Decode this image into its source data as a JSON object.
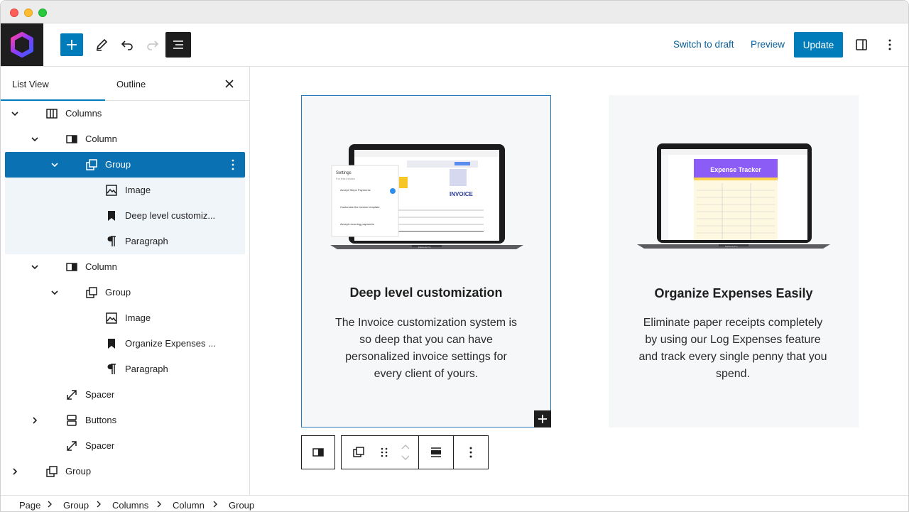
{
  "toolbar": {
    "switch_to_draft": "Switch to draft",
    "preview": "Preview",
    "update": "Update"
  },
  "panel": {
    "tabs": [
      "List View",
      "Outline"
    ],
    "active_tab": "List View",
    "tree": [
      {
        "label": "Columns",
        "icon": "columns-icon",
        "depth": 1,
        "expanded": true
      },
      {
        "label": "Column",
        "icon": "column-icon",
        "depth": 2,
        "expanded": true
      },
      {
        "label": "Group",
        "icon": "group-icon",
        "depth": 3,
        "expanded": true,
        "selected": true
      },
      {
        "label": "Image",
        "icon": "image-icon",
        "depth": 4
      },
      {
        "label": "Deep level customiz...",
        "icon": "bookmark-icon",
        "depth": 4
      },
      {
        "label": "Paragraph",
        "icon": "paragraph-icon",
        "depth": 4
      },
      {
        "label": "Column",
        "icon": "column-icon",
        "depth": 2,
        "expanded": true
      },
      {
        "label": "Group",
        "icon": "group-icon",
        "depth": 3,
        "expanded": true
      },
      {
        "label": "Image",
        "icon": "image-icon",
        "depth": 4
      },
      {
        "label": "Organize Expenses ...",
        "icon": "bookmark-icon",
        "depth": 4
      },
      {
        "label": "Paragraph",
        "icon": "paragraph-icon",
        "depth": 4
      },
      {
        "label": "Spacer",
        "icon": "spacer-icon",
        "depth": 2
      },
      {
        "label": "Buttons",
        "icon": "buttons-icon",
        "depth": 2,
        "expanded": false
      },
      {
        "label": "Spacer",
        "icon": "spacer-icon",
        "depth": 2
      },
      {
        "label": "Group",
        "icon": "group-icon",
        "depth": 1,
        "expanded": false
      }
    ]
  },
  "canvas": {
    "cards": [
      {
        "title": "Deep level customization",
        "text": "The Invoice customization system is so deep that you can have personalized invoice settings for every client of yours.",
        "laptop": {
          "settings_title": "Settings",
          "settings_sub": "For this invoice",
          "options": [
            "Accept Stripe Payments",
            "Customize the invoice template",
            "Accept recurring payments"
          ],
          "brand": "INVOICE",
          "model": "Macbook Pro"
        }
      },
      {
        "title": "Organize Expenses Easily",
        "text": "Eliminate paper receipts completely by using our Log Expenses feature and track every single penny that you spend.",
        "laptop": {
          "header": "Expense Tracker",
          "model": "Macbook Pro"
        }
      }
    ]
  },
  "breadcrumbs": [
    "Page",
    "Group",
    "Columns",
    "Column",
    "Group"
  ],
  "colors": {
    "accent": "#007cba",
    "selected_row": "#0a72b3",
    "dark": "#1e1e1e"
  }
}
